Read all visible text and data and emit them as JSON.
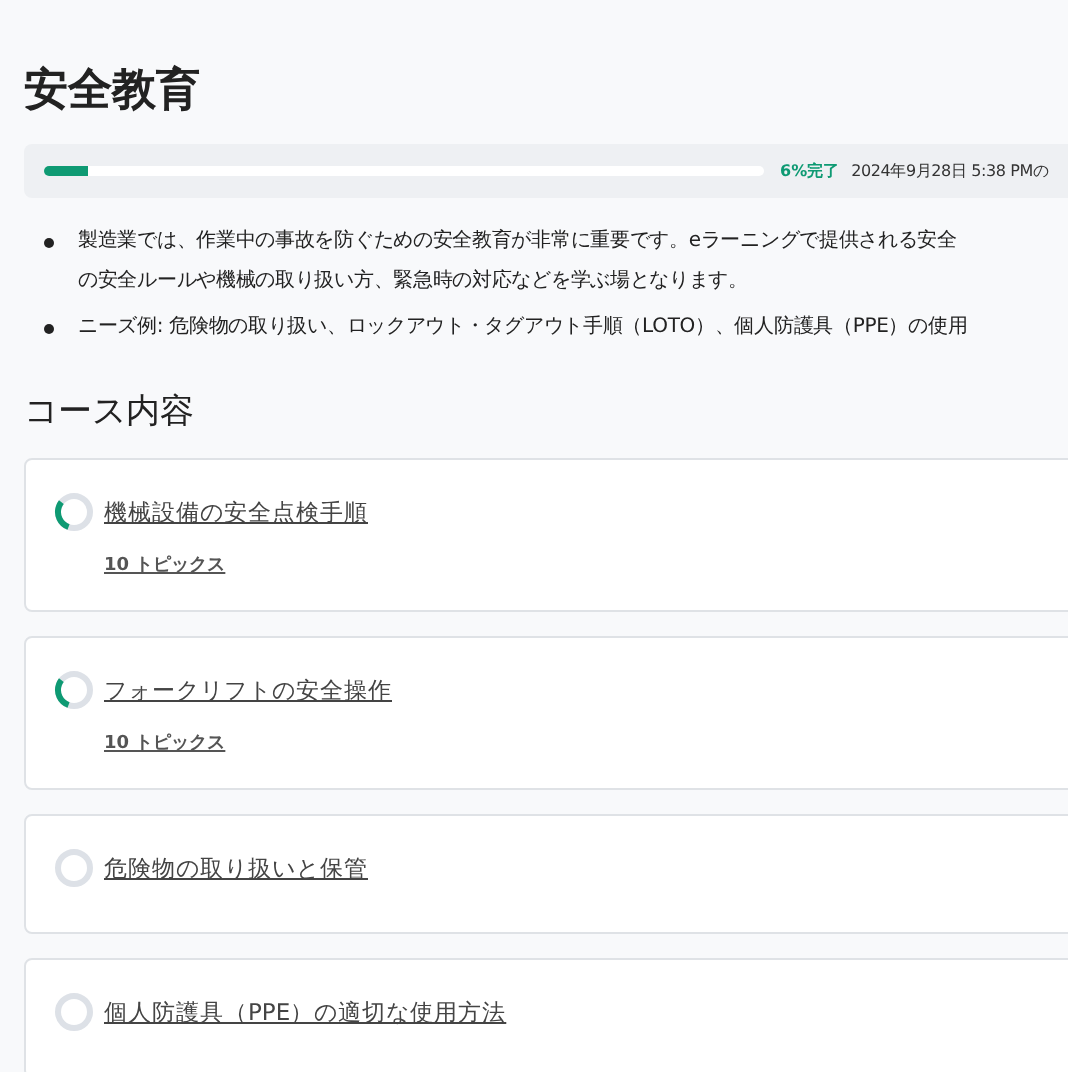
{
  "title": "安全教育",
  "progress": {
    "level": 0.06,
    "percent": "6%完了",
    "updated": "2024年9月28日 5:38 PMの"
  },
  "description": [
    {
      "lines": [
        "製造業では、作業中の事故を防ぐための安全教育が非常に重要です。eラーニングで提供される安全",
        "の安全ルールや機械の取り扱い方、緊急時の対応などを学ぶ場となります。"
      ]
    },
    {
      "lines": [
        "ニーズ例: 危険物の取り扱い、ロックアウト・タグアウト手順（LOTO）、個人防護具（PPE）の使用"
      ]
    }
  ],
  "section_title": "コース内容",
  "courses": [
    {
      "title": "機械設備の安全点検手順",
      "topics": "10 トピックス",
      "in_progress": true
    },
    {
      "title": "フォークリフトの安全操作",
      "topics": "10 トピックス",
      "in_progress": true
    },
    {
      "title": "危険物の取り扱いと保管",
      "in_progress": false
    },
    {
      "title": "個人防護具（PPE）の適切な使用方法",
      "in_progress": false
    }
  ]
}
